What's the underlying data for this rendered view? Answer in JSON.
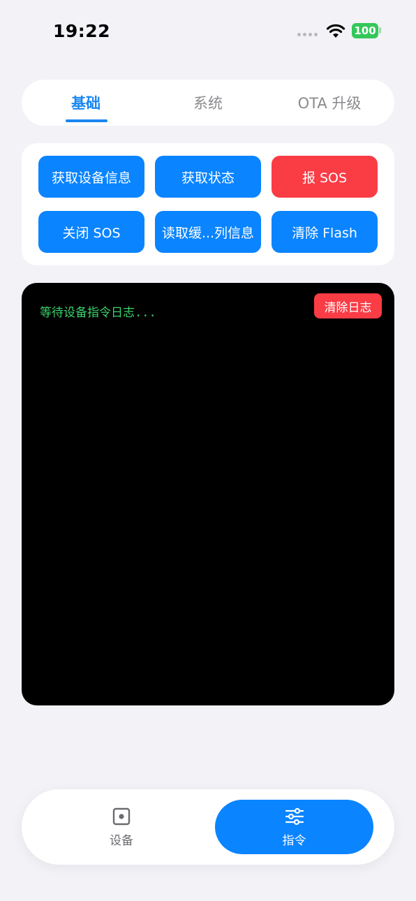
{
  "status_bar": {
    "time": "19:22",
    "battery": "100",
    "icons": [
      "cellular-dots-icon",
      "wifi-icon",
      "battery-icon"
    ],
    "battery_color": "#34c759"
  },
  "tabs": [
    {
      "label": "基础",
      "active": true
    },
    {
      "label": "系统",
      "active": false
    },
    {
      "label": "OTA 升级",
      "active": false
    }
  ],
  "commands": [
    {
      "label": "获取设备信息",
      "style": "primary"
    },
    {
      "label": "获取状态",
      "style": "primary"
    },
    {
      "label": "报 SOS",
      "style": "danger"
    },
    {
      "label": "关闭 SOS",
      "style": "primary"
    },
    {
      "label": "读取缓...列信息",
      "style": "primary"
    },
    {
      "label": "清除 Flash",
      "style": "primary"
    }
  ],
  "log": {
    "placeholder": "等待设备指令日志...",
    "clear_label": "清除日志"
  },
  "bottom_nav": [
    {
      "label": "设备",
      "icon": "device-icon",
      "active": false
    },
    {
      "label": "指令",
      "icon": "sliders-icon",
      "active": true
    }
  ],
  "colors": {
    "accent": "#0a84ff",
    "danger": "#fa3c45",
    "log_text": "#3ad26a",
    "background": "#f2f2f7"
  }
}
